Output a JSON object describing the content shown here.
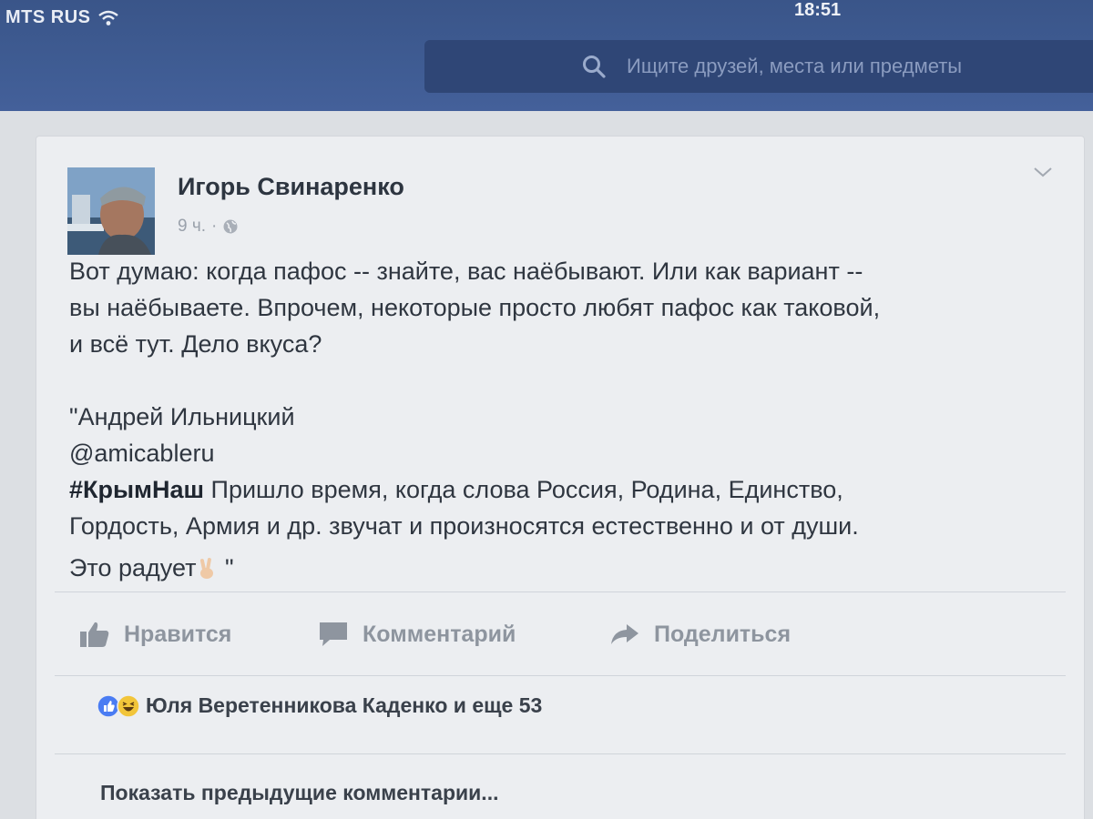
{
  "status_bar": {
    "carrier": "MTS RUS",
    "time": "18:51"
  },
  "header": {
    "search_placeholder": "Ищите друзей, места или предметы"
  },
  "post": {
    "author": "Игорь Свинаренко",
    "time": "9 ч.",
    "separator": "·",
    "privacy_icon": "globe-icon",
    "body": {
      "line1": "Вот думаю: когда пафос -- знайте, вас наёбывают. Или как вариант --",
      "line2": "вы наёбываете. Впрочем, некоторые просто любят пафос как таковой,",
      "line3": "и всё тут. Дело вкуса?",
      "quote_line1": "\"Андрей Ильницкий",
      "quote_line2": "@amicableru",
      "hashtag": "#КрымНаш",
      "quote_line3_rest": " Пришло время, когда слова Россия, Родина, Единство,",
      "quote_line4": "Гордость, Армия и др. звучат и произносятся естественно и от души.",
      "quote_line5": "Это радует",
      "quote_close": " \""
    }
  },
  "actions": {
    "like": "Нравится",
    "comment": "Комментарий",
    "share": "Поделиться"
  },
  "reactions": {
    "summary": "Юля Веретенникова Каденко и еще 53"
  },
  "comments": {
    "show_previous": "Показать предыдущие комментарии..."
  },
  "colors": {
    "header_blue": "#3f5c93",
    "search_bg": "#2f4676",
    "like_blue": "#4a7cf3",
    "haha_yellow": "#f2c53a"
  }
}
